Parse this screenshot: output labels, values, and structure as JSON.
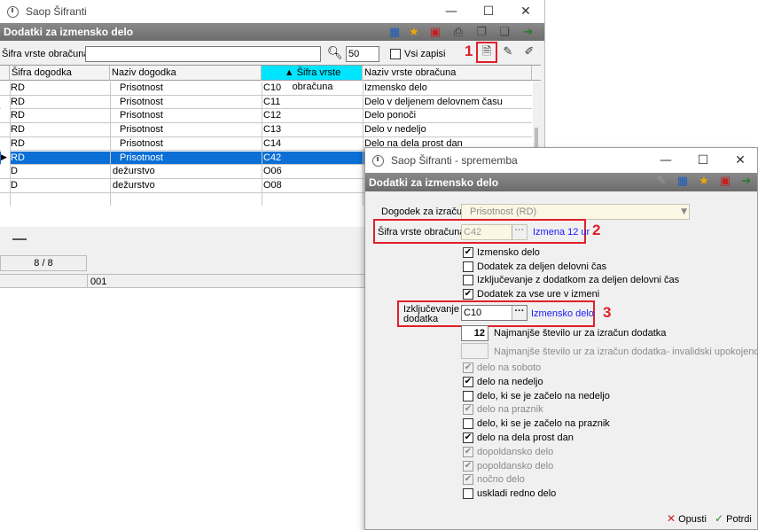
{
  "back_window": {
    "title": "Saop Šifranti",
    "header": "Dodatki za izmensko delo",
    "filter_label": "Šifra vrste obračuna",
    "filter_value": "",
    "count_value": "50",
    "all_records_label": "Vsi zapisi",
    "columns": [
      "Šifra dogodka",
      "Naziv dogodka",
      "Šifra vrste obračuna",
      "Naziv vrste obračuna"
    ],
    "rows": [
      [
        "RD",
        "Prisotnost",
        "C10",
        "Izmensko delo"
      ],
      [
        "RD",
        "Prisotnost",
        "C11",
        "Delo v deljenem delovnem času"
      ],
      [
        "RD",
        "Prisotnost",
        "C12",
        "Delo ponoči"
      ],
      [
        "RD",
        "Prisotnost",
        "C13",
        "Delo v nedeljo"
      ],
      [
        "RD",
        "Prisotnost",
        "C14",
        "Delo na dela prost dan"
      ],
      [
        "RD",
        "Prisotnost",
        "C42",
        ""
      ],
      [
        "D",
        "dežurstvo",
        "O06",
        ""
      ],
      [
        "D",
        "dežurstvo",
        "O08",
        ""
      ]
    ],
    "selected_row": 5,
    "record_counter": "8 / 8",
    "status_code": "001",
    "annotation_1": "1"
  },
  "dialog": {
    "title": "Saop Šifranti - sprememba",
    "header": "Dodatki za izmensko delo",
    "event_label": "Dogodek za izračun",
    "event_value": "Prisotnost (RD)",
    "code_label": "Šifra vrste obračuna",
    "code_value": "C42",
    "code_link": "Izmena 12 ur",
    "annotation_2": "2",
    "checks_top": [
      {
        "label": "Izmensko delo",
        "checked": true
      },
      {
        "label": "Dodatek za deljen delovni čas",
        "checked": false
      },
      {
        "label": "Izključevanje z dodatkom za deljen delovni čas",
        "checked": false
      },
      {
        "label": "Dodatek za vse ure v izmeni",
        "checked": true
      }
    ],
    "excl_label_line1": "Izključevanje",
    "excl_label_line2": "dodatka",
    "excl_value": "C10",
    "excl_link": "Izmensko delo",
    "annotation_3": "3",
    "min_hours_value": "12",
    "min_hours_label": "Najmanjše število ur za izračun dodatka",
    "min_hours_inv_value": "",
    "min_hours_inv_label": "Najmanjše število ur za izračun dodatka- invalidski upokojenci",
    "checks_bottom": [
      {
        "label": "delo na soboto",
        "checked": true,
        "disabled": true
      },
      {
        "label": "delo na nedeljo",
        "checked": true,
        "disabled": false
      },
      {
        "label": "delo, ki se je začelo na nedeljo",
        "checked": false,
        "disabled": false
      },
      {
        "label": "delo na praznik",
        "checked": true,
        "disabled": true
      },
      {
        "label": "delo, ki se je začelo na praznik",
        "checked": false,
        "disabled": false
      },
      {
        "label": "delo na dela prost dan",
        "checked": true,
        "disabled": false
      },
      {
        "label": "dopoldansko delo",
        "checked": true,
        "disabled": true
      },
      {
        "label": "popoldansko delo",
        "checked": true,
        "disabled": true
      },
      {
        "label": "nočno delo",
        "checked": true,
        "disabled": true
      },
      {
        "label": "uskladi redno delo",
        "checked": false,
        "disabled": false
      }
    ],
    "cancel_label": "Opusti",
    "confirm_label": "Potrdi"
  },
  "colors": {
    "header_gray": "#7a7a7a",
    "selection_blue": "#0b6fd6",
    "sorted_column": "#00e5ff",
    "annotation_red": "#e0202a",
    "link_blue": "#1a1aff"
  }
}
